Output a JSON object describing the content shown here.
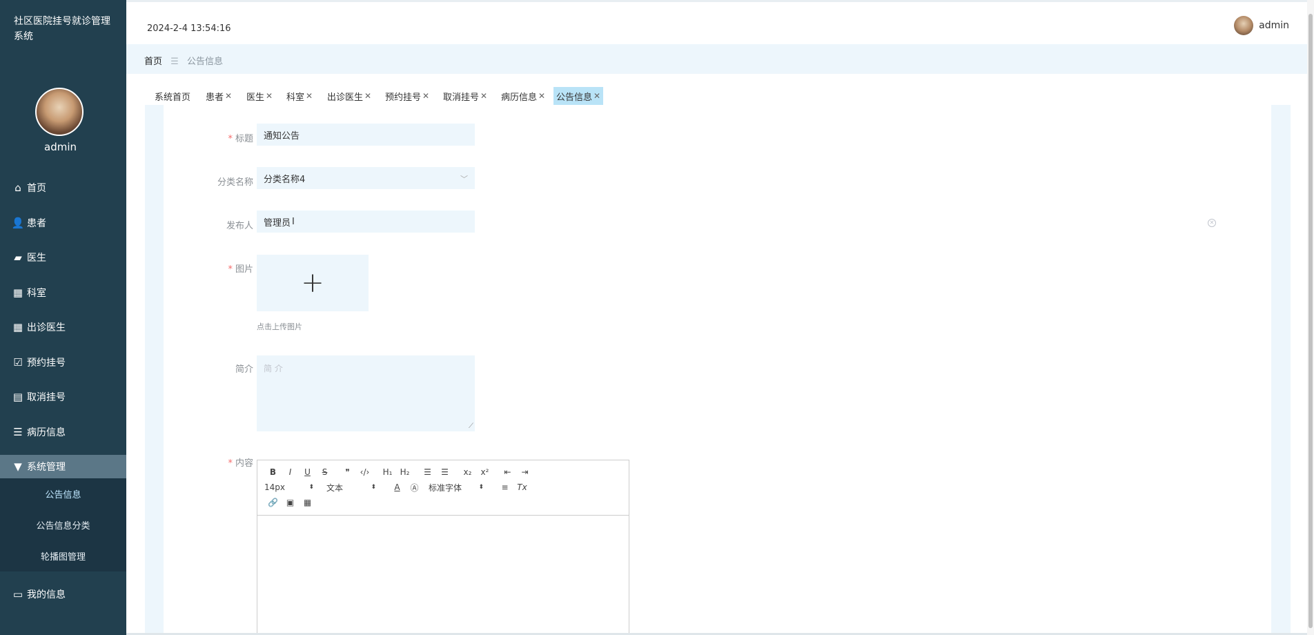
{
  "app": {
    "title": "社区医院挂号就诊管理系统"
  },
  "sidebar": {
    "username": "admin",
    "items": [
      {
        "label": "首页",
        "icon": "home-icon"
      },
      {
        "label": "患者",
        "icon": "user-icon"
      },
      {
        "label": "医生",
        "icon": "ticket-icon"
      },
      {
        "label": "科室",
        "icon": "grid-icon"
      },
      {
        "label": "出诊医生",
        "icon": "grid-icon"
      },
      {
        "label": "预约挂号",
        "icon": "clipboard-check-icon"
      },
      {
        "label": "取消挂号",
        "icon": "printer-icon"
      },
      {
        "label": "病历信息",
        "icon": "sliders-icon"
      },
      {
        "label": "系统管理",
        "icon": "brush-icon"
      }
    ],
    "submenu": [
      "公告信息",
      "公告信息分类",
      "轮播图管理"
    ],
    "bottom_item": {
      "label": "我的信息",
      "icon": "wallet-icon"
    }
  },
  "topbar": {
    "datetime": "2024-2-4 13:54:16",
    "username": "admin"
  },
  "breadcrumb": {
    "home": "首页",
    "current": "公告信息"
  },
  "tabs": [
    "系统首页",
    "患者",
    "医生",
    "科室",
    "出诊医生",
    "预约挂号",
    "取消挂号",
    "病历信息",
    "公告信息"
  ],
  "form": {
    "title_label": "标题",
    "title_value": "通知公告",
    "category_label": "分类名称",
    "category_value": "分类名称4",
    "publisher_label": "发布人",
    "publisher_value": "管理员",
    "image_label": "图片",
    "upload_tip": "点击上传图片",
    "intro_label": "简介",
    "intro_placeholder": "简 介",
    "content_label": "内容"
  },
  "editor": {
    "font_size": "14px",
    "header": "文本",
    "font_family": "标准字体"
  },
  "colors": {
    "sidebar": "#22404f",
    "active_tab": "#b9e3f7",
    "field_bg": "#edf6fc",
    "required": "#f56c6c"
  }
}
